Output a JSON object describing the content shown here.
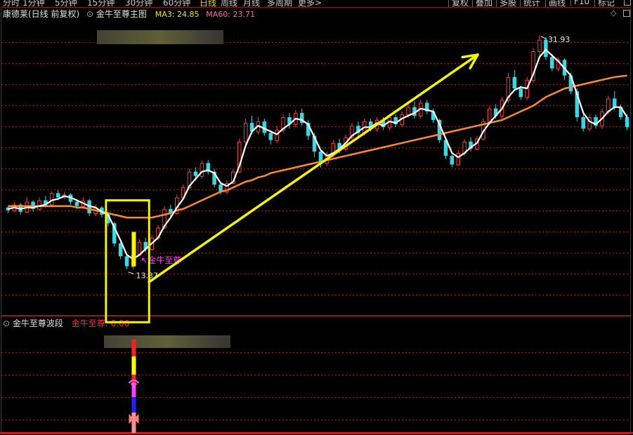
{
  "tabs": [
    "分时",
    "1分钟",
    "5分钟",
    "15分钟",
    "30分钟",
    "60分钟",
    "日线",
    "周线",
    "月线",
    "多周期",
    "更多>"
  ],
  "active_tab": "日线",
  "toolbar": [
    "复权",
    "叠加",
    "多股",
    "统计",
    "画线",
    "F10",
    "标记"
  ],
  "main_panel": {
    "stock_title": "康德莱(日线 前复权)",
    "indicator_name": "金牛至尊主图",
    "ma3_label": "MA3: 24.85",
    "ma60_label": "MA60: 23.71",
    "ma3_color": "#f3e000",
    "ma60_color": "#ff6fa8",
    "high_label": "31.93",
    "low_label": "13.37",
    "signal_label": "金牛至尊"
  },
  "sub_panel": {
    "indicator_name": "金牛至尊波段",
    "value_name": "金牛至尊:",
    "value": "0.00"
  },
  "colors": {
    "up": "#ff3c3c",
    "down": "#39d7e6",
    "white_line": "#ffffff",
    "orange_line": "#ff8a2a",
    "grid": "#8b1a1a",
    "arrow": "#f5f500",
    "box": "#f5f500"
  },
  "chart_data": {
    "type": "candlestick",
    "ylim": [
      12.5,
      33
    ],
    "candles": [
      [
        19.9,
        19.7,
        20.0,
        19.5
      ],
      [
        19.7,
        20.1,
        20.3,
        19.6
      ],
      [
        20.1,
        19.6,
        20.2,
        19.4
      ],
      [
        19.6,
        20.3,
        20.6,
        19.5
      ],
      [
        20.3,
        19.8,
        20.4,
        19.6
      ],
      [
        19.8,
        20.4,
        20.6,
        19.7
      ],
      [
        20.4,
        20.1,
        20.7,
        19.9
      ],
      [
        20.1,
        20.9,
        21.0,
        20.0
      ],
      [
        20.9,
        20.6,
        21.1,
        20.4
      ],
      [
        20.6,
        20.8,
        21.0,
        20.5
      ],
      [
        20.8,
        20.3,
        20.9,
        20.1
      ],
      [
        20.3,
        20.0,
        20.5,
        19.8
      ],
      [
        20.0,
        20.4,
        20.6,
        19.9
      ],
      [
        20.4,
        19.5,
        20.5,
        19.3
      ],
      [
        19.5,
        19.9,
        20.1,
        19.3
      ],
      [
        19.9,
        19.4,
        20.0,
        19.2
      ],
      [
        19.4,
        18.8,
        19.6,
        18.6
      ],
      [
        18.8,
        17.4,
        18.9,
        17.2
      ],
      [
        17.4,
        16.5,
        17.6,
        16.3
      ],
      [
        16.5,
        15.8,
        16.7,
        15.6
      ],
      [
        15.8,
        16.6,
        16.8,
        15.6
      ],
      [
        16.6,
        17.5,
        17.7,
        16.5
      ],
      [
        17.5,
        17.0,
        17.8,
        16.8
      ],
      [
        17.0,
        17.8,
        18.0,
        16.9
      ],
      [
        17.8,
        18.5,
        18.7,
        17.6
      ],
      [
        18.5,
        19.8,
        20.0,
        18.4
      ],
      [
        19.8,
        19.5,
        20.1,
        19.2
      ],
      [
        19.5,
        20.6,
        20.8,
        19.4
      ],
      [
        20.6,
        21.3,
        21.5,
        20.4
      ],
      [
        21.3,
        22.4,
        22.6,
        21.2
      ],
      [
        22.4,
        22.1,
        22.7,
        21.8
      ],
      [
        22.1,
        23.0,
        23.2,
        21.9
      ],
      [
        23.0,
        22.4,
        23.2,
        22.2
      ],
      [
        22.4,
        21.5,
        22.6,
        21.3
      ],
      [
        21.5,
        21.0,
        21.7,
        20.8
      ],
      [
        21.0,
        21.6,
        21.8,
        20.8
      ],
      [
        21.6,
        22.4,
        22.6,
        21.5
      ],
      [
        22.4,
        24.5,
        24.7,
        22.3
      ],
      [
        24.5,
        25.8,
        26.1,
        24.3
      ],
      [
        25.8,
        25.2,
        26.3,
        25.0
      ],
      [
        25.2,
        25.9,
        26.2,
        25.0
      ],
      [
        25.9,
        25.1,
        26.1,
        24.9
      ],
      [
        25.1,
        24.6,
        25.3,
        24.3
      ],
      [
        24.6,
        25.3,
        25.6,
        24.4
      ],
      [
        25.3,
        26.2,
        26.4,
        25.1
      ],
      [
        26.2,
        25.7,
        26.5,
        25.4
      ],
      [
        25.7,
        26.5,
        26.7,
        25.5
      ],
      [
        26.5,
        25.8,
        26.8,
        25.6
      ],
      [
        25.8,
        24.9,
        26.0,
        24.6
      ],
      [
        24.9,
        23.8,
        25.1,
        23.4
      ],
      [
        23.8,
        23.0,
        24.0,
        22.7
      ],
      [
        23.0,
        23.6,
        23.8,
        22.8
      ],
      [
        23.6,
        24.4,
        24.6,
        23.4
      ],
      [
        24.4,
        24.0,
        24.7,
        23.7
      ],
      [
        24.0,
        24.8,
        25.0,
        23.8
      ],
      [
        24.8,
        25.6,
        25.8,
        24.6
      ],
      [
        25.6,
        25.1,
        25.9,
        24.9
      ],
      [
        25.1,
        25.9,
        26.1,
        24.9
      ],
      [
        25.9,
        25.4,
        26.1,
        25.2
      ],
      [
        25.4,
        26.0,
        26.2,
        25.2
      ],
      [
        26.0,
        25.5,
        26.2,
        25.3
      ],
      [
        25.5,
        26.2,
        26.4,
        25.3
      ],
      [
        26.2,
        25.7,
        26.4,
        25.5
      ],
      [
        25.7,
        26.4,
        26.6,
        25.5
      ],
      [
        26.4,
        26.9,
        27.1,
        26.2
      ],
      [
        26.9,
        26.3,
        27.3,
        26.1
      ],
      [
        26.3,
        27.2,
        27.4,
        26.1
      ],
      [
        27.2,
        26.6,
        27.4,
        26.4
      ],
      [
        26.6,
        26.0,
        26.8,
        25.8
      ],
      [
        26.0,
        24.6,
        26.1,
        24.4
      ],
      [
        24.6,
        23.5,
        24.7,
        23.3
      ],
      [
        23.5,
        22.9,
        23.6,
        22.7
      ],
      [
        22.9,
        23.7,
        23.9,
        22.8
      ],
      [
        23.7,
        24.5,
        24.7,
        23.5
      ],
      [
        24.5,
        24.0,
        24.8,
        23.8
      ],
      [
        24.0,
        24.7,
        24.9,
        23.9
      ],
      [
        24.7,
        25.9,
        26.1,
        24.6
      ],
      [
        25.9,
        26.8,
        27.0,
        25.7
      ],
      [
        26.8,
        26.3,
        27.1,
        26.1
      ],
      [
        26.3,
        27.4,
        27.6,
        26.1
      ],
      [
        27.4,
        29.0,
        29.3,
        27.2
      ],
      [
        29.0,
        28.2,
        29.5,
        28.0
      ],
      [
        28.2,
        27.6,
        28.4,
        27.4
      ],
      [
        27.6,
        28.8,
        29.0,
        27.4
      ],
      [
        28.8,
        30.8,
        31.0,
        28.6
      ],
      [
        30.8,
        31.6,
        31.93,
        30.5
      ],
      [
        31.6,
        30.4,
        31.8,
        30.2
      ],
      [
        30.4,
        29.6,
        30.6,
        29.4
      ],
      [
        29.6,
        30.2,
        30.4,
        29.4
      ],
      [
        30.2,
        29.1,
        30.3,
        28.8
      ],
      [
        29.1,
        28.0,
        29.3,
        27.8
      ],
      [
        28.0,
        26.2,
        28.2,
        25.9
      ],
      [
        26.2,
        25.4,
        26.4,
        25.2
      ],
      [
        25.4,
        26.2,
        26.4,
        25.2
      ],
      [
        26.2,
        25.6,
        26.4,
        25.4
      ],
      [
        25.6,
        26.6,
        26.8,
        25.4
      ],
      [
        26.6,
        27.5,
        27.7,
        26.4
      ],
      [
        27.5,
        26.9,
        28.0,
        26.7
      ],
      [
        26.9,
        26.2,
        27.1,
        26.0
      ],
      [
        26.2,
        25.5,
        26.4,
        25.3
      ]
    ],
    "ma3": [
      19.8,
      19.9,
      19.8,
      19.9,
      19.9,
      20.0,
      20.1,
      20.4,
      20.5,
      20.7,
      20.6,
      20.4,
      20.2,
      20.0,
      19.9,
      19.6,
      19.4,
      18.5,
      17.6,
      16.6,
      16.3,
      16.6,
      17.0,
      17.4,
      17.8,
      18.6,
      19.2,
      19.9,
      20.5,
      21.4,
      21.9,
      22.4,
      22.5,
      22.3,
      21.6,
      21.4,
      21.7,
      22.8,
      24.2,
      25.2,
      25.6,
      25.4,
      25.2,
      25.0,
      25.4,
      25.7,
      26.1,
      26.0,
      25.7,
      24.8,
      23.9,
      23.5,
      23.7,
      24.0,
      24.4,
      24.9,
      25.2,
      25.5,
      25.5,
      25.8,
      25.6,
      25.9,
      25.8,
      26.1,
      26.3,
      26.5,
      26.8,
      26.7,
      26.6,
      25.7,
      24.7,
      23.7,
      23.4,
      23.7,
      24.1,
      24.4,
      25.2,
      25.8,
      26.3,
      26.8,
      27.6,
      28.1,
      28.3,
      28.2,
      29.2,
      30.4,
      30.9,
      30.5,
      30.1,
      29.6,
      29.1,
      27.8,
      26.5,
      25.9,
      25.7,
      26.1,
      26.6,
      26.9,
      26.9,
      26.2
    ],
    "ma60": [
      20.0,
      20.0,
      20.0,
      20.0,
      20.0,
      20.0,
      20.0,
      20.0,
      20.0,
      20.0,
      20.0,
      19.9,
      19.9,
      19.8,
      19.7,
      19.6,
      19.5,
      19.4,
      19.3,
      19.2,
      19.2,
      19.2,
      19.2,
      19.2,
      19.3,
      19.4,
      19.5,
      19.7,
      19.8,
      20.0,
      20.2,
      20.4,
      20.6,
      20.8,
      21.0,
      21.1,
      21.3,
      21.5,
      21.7,
      21.8,
      22.0,
      22.1,
      22.3,
      22.4,
      22.5,
      22.6,
      22.7,
      22.8,
      22.9,
      23.0,
      23.1,
      23.2,
      23.3,
      23.4,
      23.5,
      23.6,
      23.7,
      23.8,
      23.9,
      24.0,
      24.1,
      24.2,
      24.3,
      24.4,
      24.5,
      24.6,
      24.7,
      24.8,
      24.9,
      25.0,
      25.1,
      25.2,
      25.3,
      25.4,
      25.5,
      25.6,
      25.7,
      25.8,
      25.9,
      26.0,
      26.2,
      26.4,
      26.6,
      26.8,
      27.0,
      27.3,
      27.6,
      27.8,
      28.0,
      28.2,
      28.3,
      28.4,
      28.5,
      28.6,
      28.7,
      28.8,
      28.9,
      29.0,
      29.05,
      29.1
    ]
  }
}
